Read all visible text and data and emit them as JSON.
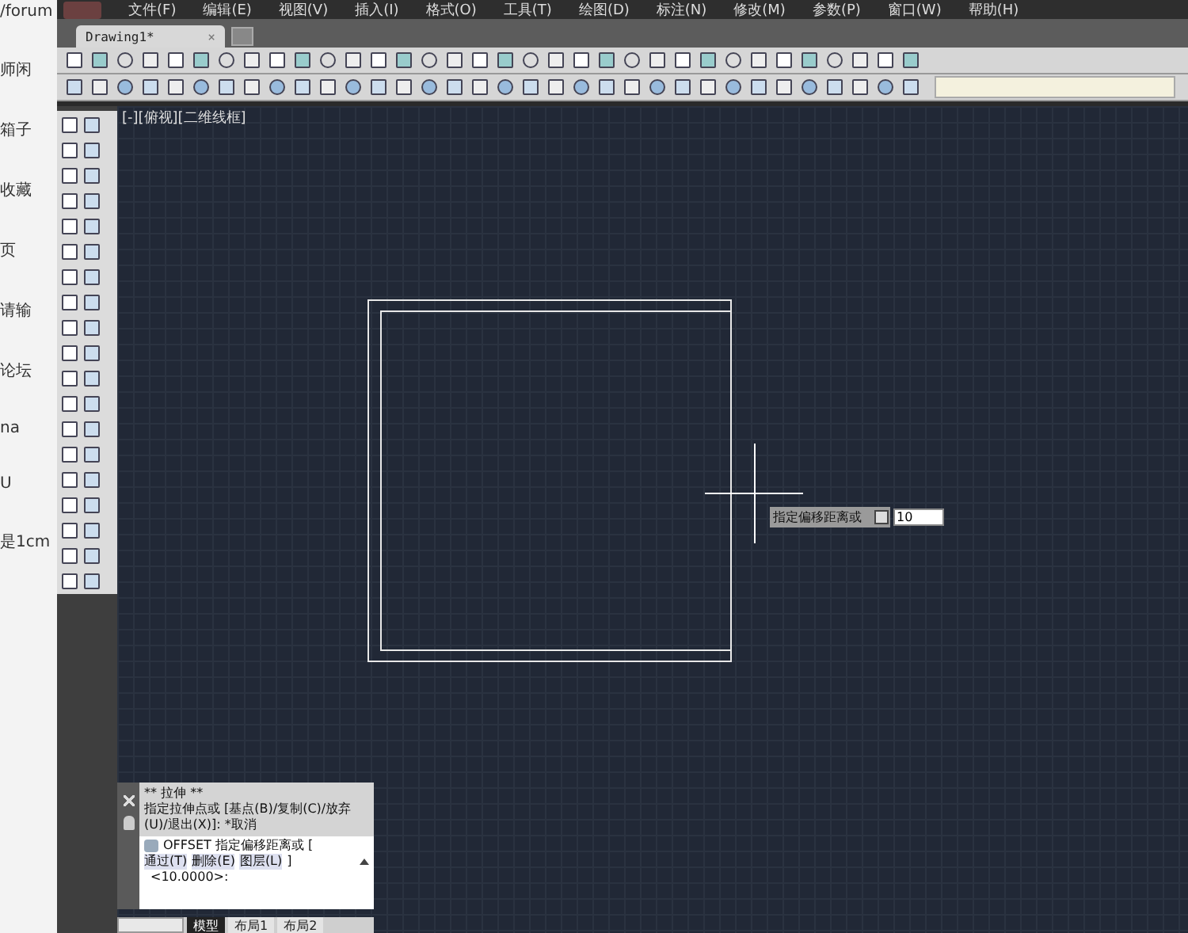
{
  "browser_strip": {
    "texts": [
      "/forum",
      "师闲",
      "箱子",
      "收藏",
      "页",
      "请输",
      "论坛",
      "na",
      "U",
      "是1cm"
    ]
  },
  "menu": [
    "文件(F)",
    "编辑(E)",
    "视图(V)",
    "插入(I)",
    "格式(O)",
    "工具(T)",
    "绘图(D)",
    "标注(N)",
    "修改(M)",
    "参数(P)",
    "窗口(W)",
    "帮助(H)"
  ],
  "document_tabs": [
    {
      "label": "Drawing1*",
      "close": "×",
      "selected": true
    }
  ],
  "viewport": {
    "label": "[-][俯视][二维线框]",
    "dynamic_input": {
      "prompt": "指定偏移距离或",
      "value": "10"
    }
  },
  "command_window": {
    "history": [
      "** 拉伸 **",
      "指定拉伸点或 [基点(B)/复制(C)/放弃(U)/退出(X)]: *取消"
    ],
    "command": "OFFSET 指定偏移距离或 [",
    "options": [
      "通过(T)",
      "删除(E)",
      "图层(L)"
    ],
    "options_end": "]",
    "prompt": "<10.0000>:"
  },
  "layout_tabs": [
    {
      "label": "模型",
      "selected": true
    },
    {
      "label": "布局1",
      "selected": false
    },
    {
      "label": "布局2",
      "selected": false
    }
  ]
}
